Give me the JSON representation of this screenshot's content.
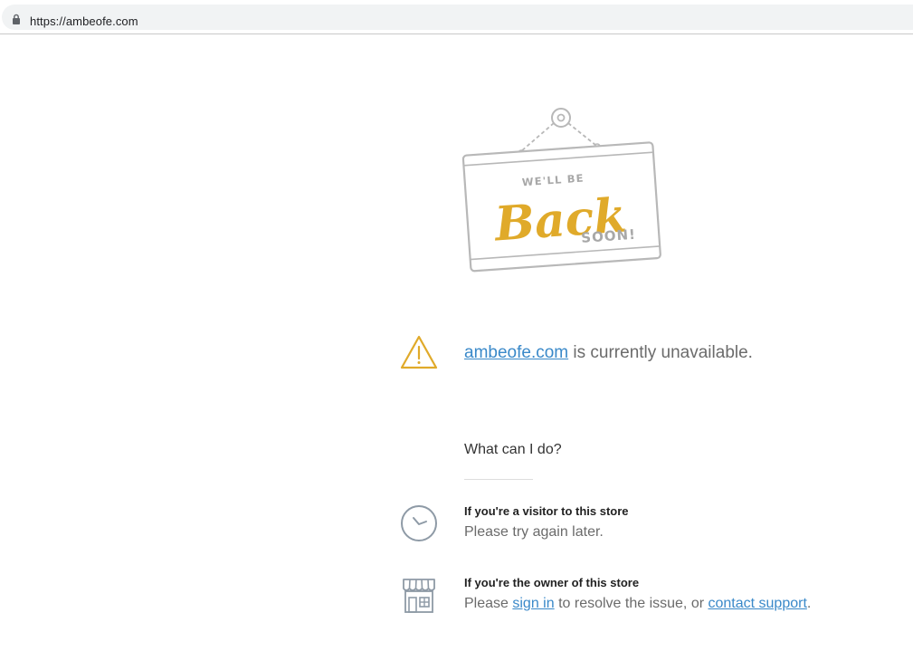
{
  "browser": {
    "url": "https://ambeofe.com",
    "lock_icon": "lock-icon"
  },
  "sign": {
    "line1": "WE'LL BE",
    "line2": "Back",
    "line3": "SOON!",
    "accent_color": "#e0aa2a"
  },
  "status": {
    "domain_link": "ambeofe.com",
    "message": " is currently unavailable.",
    "icon": "warning-icon"
  },
  "help": {
    "heading": "What can I do?",
    "visitor": {
      "icon": "clock-icon",
      "title": "If you're a visitor to this store",
      "text": "Please try again later."
    },
    "owner": {
      "icon": "store-icon",
      "title": "If you're the owner of this store",
      "text_before": "Please ",
      "sign_in_link": "sign in",
      "text_middle": " to resolve the issue, or ",
      "support_link": "contact support",
      "text_after": "."
    }
  },
  "colors": {
    "link": "#3a89c9",
    "warning": "#e0aa2a",
    "icon_gray": "#8e9aa6"
  }
}
